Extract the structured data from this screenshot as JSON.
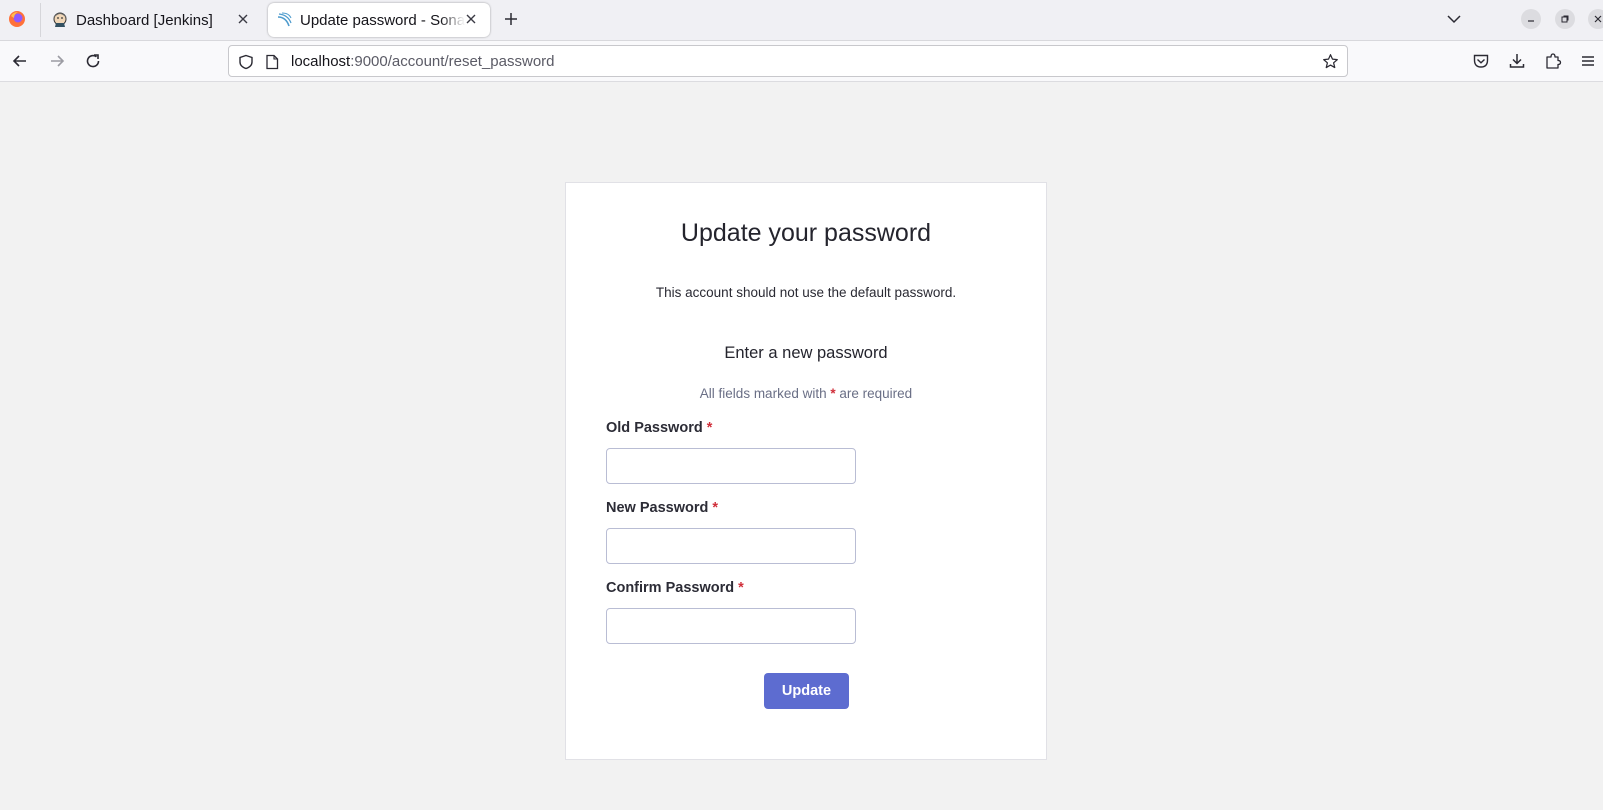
{
  "browser": {
    "tabs": [
      {
        "title": "Dashboard [Jenkins]",
        "active": false
      },
      {
        "title": "Update password - SonarQube",
        "active": true
      }
    ],
    "url": {
      "host": "localhost",
      "rest": ":9000/account/reset_password"
    }
  },
  "page": {
    "title": "Update your password",
    "notice": "This account should not use the default password.",
    "subtitle": "Enter a new password",
    "required_prefix": "All fields marked with",
    "required_star": "*",
    "required_suffix": "are required",
    "fields": [
      {
        "label": "Old Password",
        "star": "*",
        "value": ""
      },
      {
        "label": "New Password",
        "star": "*",
        "value": ""
      },
      {
        "label": "Confirm Password",
        "star": "*",
        "value": ""
      }
    ],
    "submit_label": "Update"
  },
  "colors": {
    "accent": "#5d6cd0",
    "required": "#d02f3a",
    "background": "#f2f2f2"
  }
}
